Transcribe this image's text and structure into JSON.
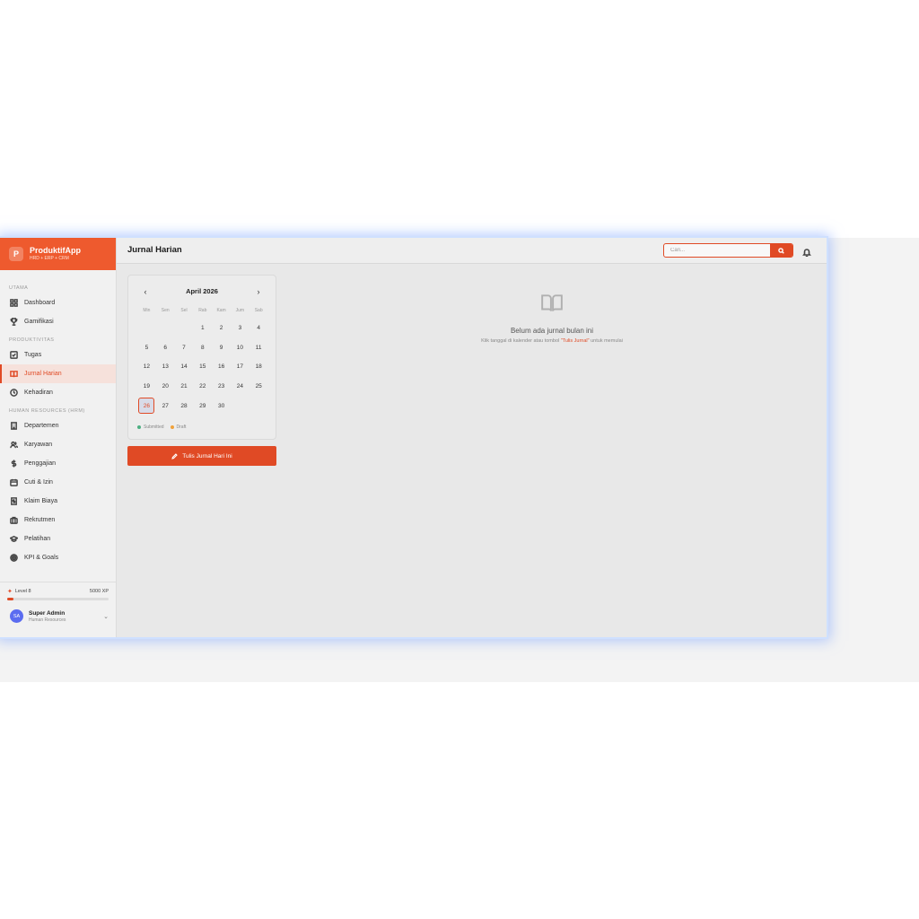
{
  "brand": {
    "logo_letter": "P",
    "name": "ProduktifApp",
    "subtitle": "HRD + ERP + CRM"
  },
  "sidebar": {
    "sections": [
      {
        "title": "UTAMA",
        "items": [
          {
            "label": "Dashboard",
            "icon": "grid-icon"
          },
          {
            "label": "Gamifikasi",
            "icon": "trophy-icon"
          }
        ]
      },
      {
        "title": "PRODUKTIVITAS",
        "items": [
          {
            "label": "Tugas",
            "icon": "checkbox-icon"
          },
          {
            "label": "Jurnal Harian",
            "icon": "book-icon",
            "active": true
          },
          {
            "label": "Kehadiran",
            "icon": "clock-icon"
          }
        ]
      },
      {
        "title": "HUMAN RESOURCES (HRM)",
        "items": [
          {
            "label": "Departemen",
            "icon": "building-icon"
          },
          {
            "label": "Karyawan",
            "icon": "users-icon"
          },
          {
            "label": "Penggajian",
            "icon": "dollar-icon"
          },
          {
            "label": "Cuti & Izin",
            "icon": "calendar-icon"
          },
          {
            "label": "Klaim Biaya",
            "icon": "receipt-icon"
          },
          {
            "label": "Rekrutmen",
            "icon": "briefcase-icon"
          },
          {
            "label": "Pelatihan",
            "icon": "graduation-cap-icon"
          },
          {
            "label": "KPI & Goals",
            "icon": "target-icon"
          }
        ]
      }
    ],
    "level": {
      "label": "Level 8",
      "xp": "5000 XP",
      "progress_pct": 6
    },
    "user": {
      "initials": "SA",
      "name": "Super Admin",
      "role": "Human Resources"
    }
  },
  "header": {
    "title": "Jurnal Harian",
    "search_placeholder": "Cari..."
  },
  "calendar": {
    "month_label": "April 2026",
    "prev": "‹",
    "next": "›",
    "weekdays": [
      "Min",
      "Sen",
      "Sel",
      "Rab",
      "Kam",
      "Jum",
      "Sab"
    ],
    "weeks": [
      [
        "",
        "",
        "",
        "1",
        "2",
        "3",
        "4"
      ],
      [
        "5",
        "6",
        "7",
        "8",
        "9",
        "10",
        "11"
      ],
      [
        "12",
        "13",
        "14",
        "15",
        "16",
        "17",
        "18"
      ],
      [
        "19",
        "20",
        "21",
        "22",
        "23",
        "24",
        "25"
      ],
      [
        "26",
        "27",
        "28",
        "29",
        "30",
        "",
        ""
      ]
    ],
    "today": "26",
    "legend": [
      {
        "label": "Submitted",
        "color": "#4caf82"
      },
      {
        "label": "Draft",
        "color": "#f0a13a"
      }
    ]
  },
  "write_button": "Tulis Jurnal Hari Ini",
  "empty_state": {
    "title": "Belum ada jurnal bulan ini",
    "desc_before": "Klik tanggal di kalender atau tombol ",
    "desc_highlight": "\"Tulis Jurnal\"",
    "desc_after": " untuk memulai"
  },
  "colors": {
    "accent": "#e04a25",
    "brand_header": "#ee5a2e"
  }
}
